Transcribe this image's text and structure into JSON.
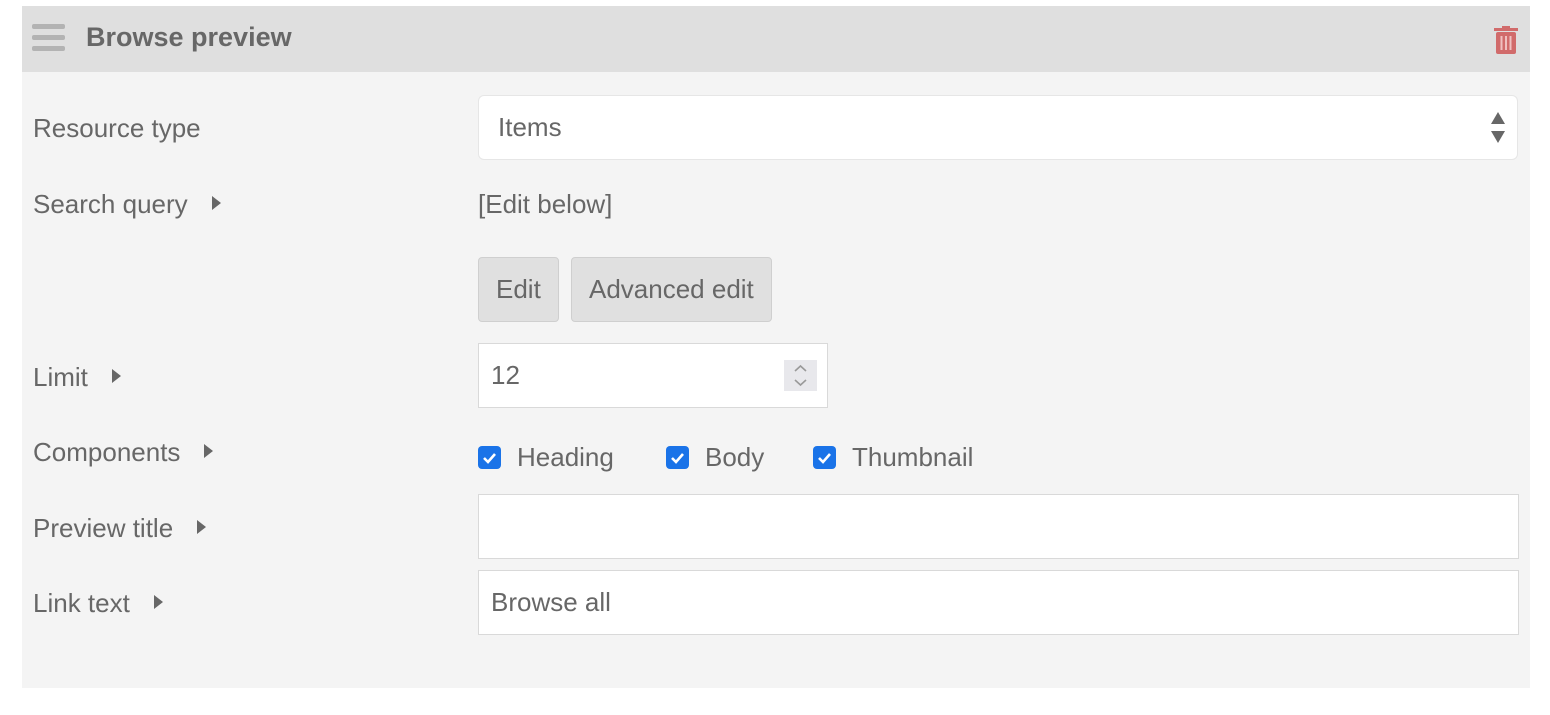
{
  "header": {
    "title": "Browse preview",
    "menu_icon": "hamburger-icon",
    "delete_icon": "trash-icon",
    "delete_color": "#d16b6b"
  },
  "fields": {
    "resource_type": {
      "label": "Resource type",
      "value": "Items"
    },
    "search_query": {
      "label": "Search query",
      "value": "[Edit below]",
      "edit_label": "Edit",
      "advanced_edit_label": "Advanced edit"
    },
    "limit": {
      "label": "Limit",
      "value": "12"
    },
    "components": {
      "label": "Components",
      "options": [
        {
          "label": "Heading",
          "checked": true
        },
        {
          "label": "Body",
          "checked": true
        },
        {
          "label": "Thumbnail",
          "checked": true
        }
      ]
    },
    "preview_title": {
      "label": "Preview title",
      "value": ""
    },
    "link_text": {
      "label": "Link text",
      "value": "Browse all"
    }
  },
  "colors": {
    "accent": "#1a73e8"
  }
}
